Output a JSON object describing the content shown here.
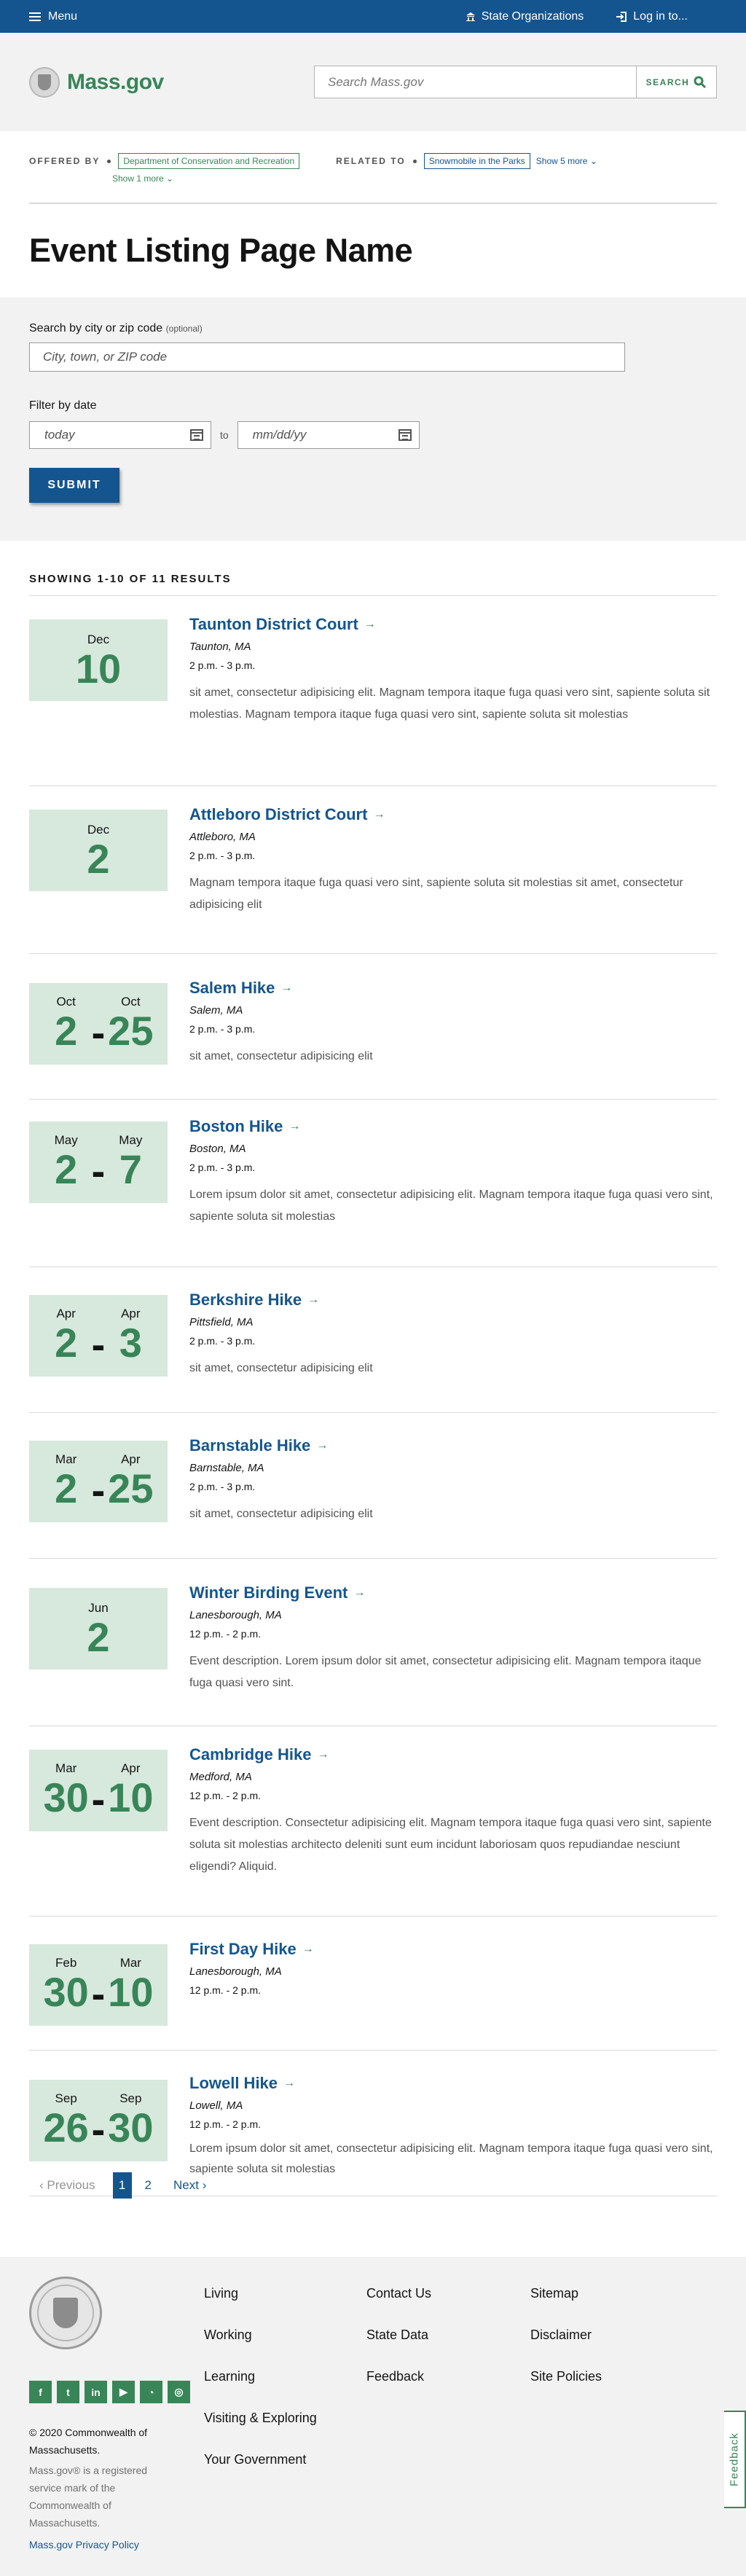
{
  "topbar": {
    "menu": "Menu",
    "state_orgs": "State Organizations",
    "login": "Log in to..."
  },
  "header": {
    "logo": "Mass.gov",
    "search_placeholder": "Search Mass.gov",
    "search_button": "SEARCH"
  },
  "relationship": {
    "offered_by_label": "OFFERED BY",
    "offered_by": "Department of Conservation and Recreation",
    "show_more_offered": "Show 1 more",
    "related_label": "RELATED TO",
    "related": "Snowmobile in the Parks",
    "show_more_related": "Show 5 more"
  },
  "page_title": "Event Listing Page Name",
  "search_form": {
    "city_label": "Search by city or zip code",
    "city_optional": "(optional)",
    "city_placeholder": "City, town, or ZIP code",
    "filter_label": "Filter by date",
    "date_from": "today",
    "date_to_word": "to",
    "date_to": "mm/dd/yy",
    "submit": "SUBMIT"
  },
  "results": {
    "count_text": "SHOWING 1-10 OF 11 RESULTS",
    "events": [
      {
        "start_month": "Dec",
        "start_day": "10",
        "title": "Taunton District Court",
        "location": "Taunton, MA",
        "time": "2 p.m. - 3 p.m.",
        "description": "sit amet, consectetur adipisicing elit. Magnam tempora itaque fuga quasi vero sint, sapiente soluta sit molestias. Magnam tempora itaque fuga quasi vero sint, sapiente soluta sit molestias"
      },
      {
        "start_month": "Dec",
        "start_day": "2",
        "title": "Attleboro District Court",
        "location": "Attleboro, MA",
        "time": "2 p.m. - 3 p.m.",
        "description": "Magnam tempora itaque fuga quasi vero sint, sapiente soluta sit molestias sit amet, consectetur adipisicing elit"
      },
      {
        "start_month": "Oct",
        "start_day": "2",
        "end_month": "Oct",
        "end_day": "25",
        "title": "Salem Hike",
        "location": "Salem, MA",
        "time": "2 p.m. - 3 p.m.",
        "description": "sit amet, consectetur adipisicing elit"
      },
      {
        "start_month": "May",
        "start_day": "2",
        "end_month": "May",
        "end_day": "7",
        "title": "Boston Hike",
        "location": "Boston, MA",
        "time": "2 p.m. - 3 p.m.",
        "description": "Lorem ipsum dolor sit amet, consectetur adipisicing elit. Magnam tempora itaque fuga quasi vero sint, sapiente soluta sit molestias"
      },
      {
        "start_month": "Apr",
        "start_day": "2",
        "end_month": "Apr",
        "end_day": "3",
        "title": "Berkshire Hike",
        "location": "Pittsfield, MA",
        "time": "2 p.m. - 3 p.m.",
        "description": "sit amet, consectetur adipisicing elit"
      },
      {
        "start_month": "Mar",
        "start_day": "2",
        "end_month": "Apr",
        "end_day": "25",
        "title": "Barnstable Hike",
        "location": "Barnstable, MA",
        "time": "2 p.m. - 3 p.m.",
        "description": "sit amet, consectetur adipisicing elit"
      },
      {
        "start_month": "Jun",
        "start_day": "2",
        "title": "Winter Birding Event",
        "location": "Lanesborough, MA",
        "time": "12 p.m. - 2 p.m.",
        "description": "Event description. Lorem ipsum dolor sit amet, consectetur adipisicing elit. Magnam tempora itaque fuga quasi vero sint."
      },
      {
        "start_month": "Mar",
        "start_day": "30",
        "end_month": "Apr",
        "end_day": "10",
        "title": "Cambridge Hike",
        "location": "Medford, MA",
        "time": "12 p.m. - 2 p.m.",
        "description": "Event description. Consectetur adipisicing elit. Magnam tempora itaque fuga quasi vero sint, sapiente soluta sit molestias architecto deleniti sunt eum incidunt laboriosam quos repudiandae nesciunt eligendi? Aliquid."
      },
      {
        "start_month": "Feb",
        "start_day": "30",
        "end_month": "Mar",
        "end_day": "10",
        "title": "First Day Hike",
        "location": "Lanesborough, MA",
        "time": "12 p.m. - 2 p.m.",
        "description": ""
      },
      {
        "start_month": "Sep",
        "start_day": "26",
        "end_month": "Sep",
        "end_day": "30",
        "title": "Lowell Hike",
        "location": "Lowell, MA",
        "time": "12 p.m. - 2 p.m.",
        "description": "Lorem ipsum dolor sit amet, consectetur adipisicing elit. Magnam tempora itaque fuga quasi vero sint, sapiente soluta sit molestias"
      }
    ]
  },
  "pagination": {
    "previous": "Previous",
    "current": "1",
    "page2": "2",
    "next": "Next"
  },
  "footer": {
    "col1": [
      "Living",
      "Working",
      "Learning",
      "Visiting & Exploring",
      "Your Government"
    ],
    "col2": [
      "Contact Us",
      "State Data",
      "Feedback"
    ],
    "col3": [
      "Sitemap",
      "Disclaimer",
      "Site Policies"
    ],
    "social_icons": [
      "facebook-icon",
      "twitter-icon",
      "linkedin-icon",
      "youtube-icon",
      "rss-icon",
      "instagram-icon"
    ],
    "copyright": "© 2020 Commonwealth of Massachusetts.",
    "trademark": "Mass.gov® is a registered service mark of the Commonwealth of Massachusetts.",
    "privacy": "Mass.gov Privacy Policy"
  },
  "feedback_tab": "Feedback",
  "colors": {
    "brand_blue": "#14558f",
    "brand_green": "#388557",
    "badge_bg": "#d7e8dd"
  }
}
